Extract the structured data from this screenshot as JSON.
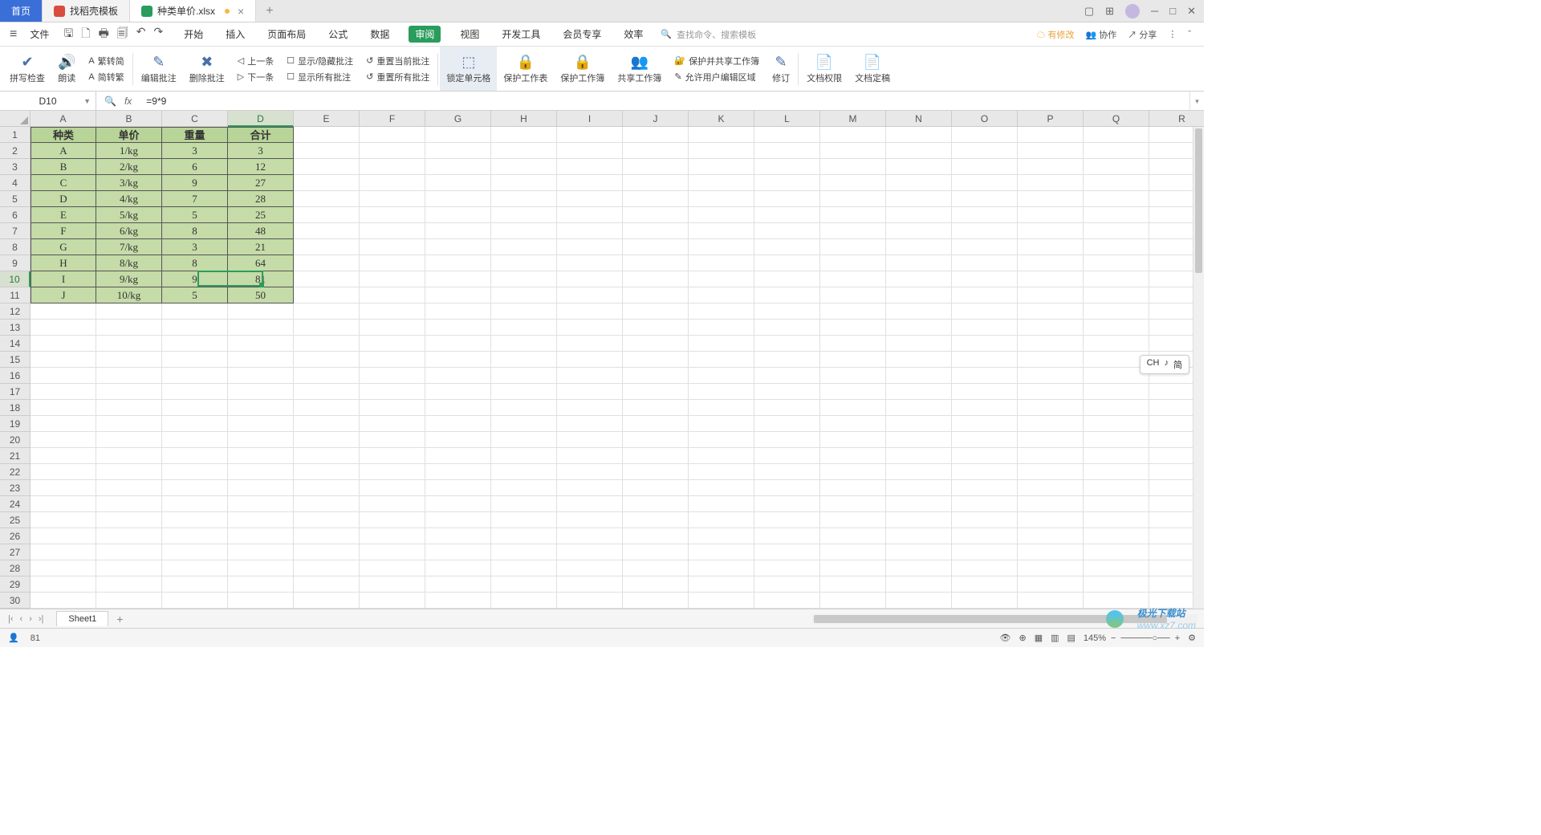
{
  "tabs": {
    "home": "首页",
    "template": "找稻壳模板",
    "file": "种类单价.xlsx"
  },
  "menubar": {
    "file": "文件",
    "items": [
      "开始",
      "插入",
      "页面布局",
      "公式",
      "数据",
      "审阅",
      "视图",
      "开发工具",
      "会员专享",
      "效率"
    ],
    "search_hint": "查找命令、搜索模板",
    "right": {
      "changes": "有修改",
      "collab": "协作",
      "share": "分享"
    }
  },
  "ribbon": {
    "spellcheck": "拼写检查",
    "read": "朗读",
    "fanzhuan": "繁转简",
    "jianzhuan": "简转繁",
    "editcmt": "编辑批注",
    "delcmt": "删除批注",
    "prev": "上一条",
    "next": "下一条",
    "showhide": "显示/隐藏批注",
    "showall": "显示所有批注",
    "resetcur": "重置当前批注",
    "resetall": "重置所有批注",
    "lockcell": "锁定单元格",
    "protectsheet": "保护工作表",
    "protectbook": "保护工作簿",
    "sharebook": "共享工作簿",
    "protectshare": "保护并共享工作簿",
    "allowedit": "允许用户编辑区域",
    "track": "修订",
    "docperm": "文档权限",
    "docfinal": "文档定稿"
  },
  "namebox": "D10",
  "formula": "=9*9",
  "columns": [
    "A",
    "B",
    "C",
    "D",
    "E",
    "F",
    "G",
    "H",
    "I",
    "J",
    "K",
    "L",
    "M",
    "N",
    "O",
    "P",
    "Q",
    "R"
  ],
  "sel": {
    "row": 10,
    "col": 4
  },
  "table": {
    "headers": [
      "种类",
      "单价",
      "重量",
      "合计"
    ],
    "rows": [
      [
        "A",
        "1/kg",
        "3",
        "3"
      ],
      [
        "B",
        "2/kg",
        "6",
        "12"
      ],
      [
        "C",
        "3/kg",
        "9",
        "27"
      ],
      [
        "D",
        "4/kg",
        "7",
        "28"
      ],
      [
        "E",
        "5/kg",
        "5",
        "25"
      ],
      [
        "F",
        "6/kg",
        "8",
        "48"
      ],
      [
        "G",
        "7/kg",
        "3",
        "21"
      ],
      [
        "H",
        "8/kg",
        "8",
        "64"
      ],
      [
        "I",
        "9/kg",
        "9",
        "81"
      ],
      [
        "J",
        "10/kg",
        "5",
        "50"
      ]
    ]
  },
  "sheet": "Sheet1",
  "status": {
    "value": "81",
    "zoom": "145%"
  },
  "ime": {
    "lang": "CH",
    "mode": "简"
  },
  "watermark": {
    "brand": "极光下载站",
    "url": "www.xz7.com"
  }
}
